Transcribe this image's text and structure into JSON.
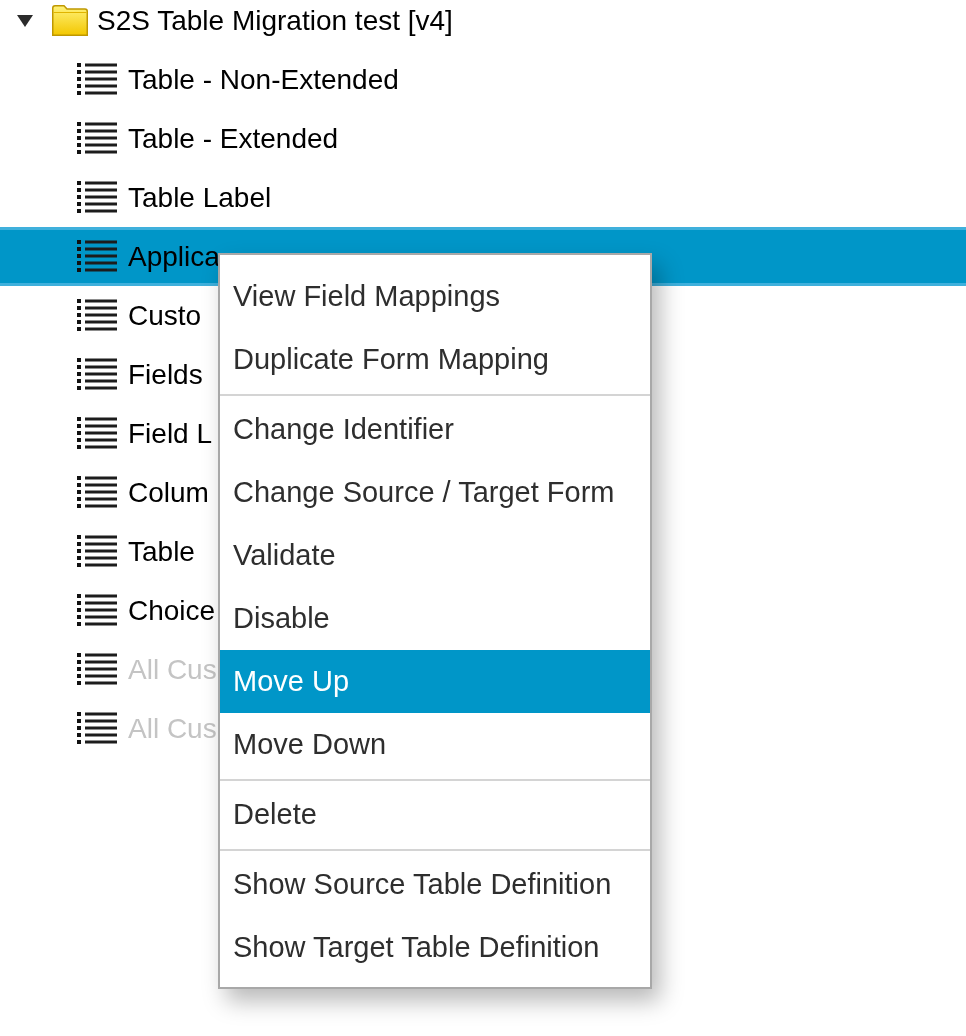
{
  "tree": {
    "root": {
      "label": "S2S Table Migration test [v4]",
      "expanded": true,
      "children": [
        {
          "label": "Table - Non-Extended",
          "selected": false,
          "disabled": false
        },
        {
          "label": "Table - Extended",
          "selected": false,
          "disabled": false
        },
        {
          "label": "Table Label",
          "selected": false,
          "disabled": false
        },
        {
          "label": "Applica",
          "selected": true,
          "disabled": false
        },
        {
          "label": "Custo",
          "selected": false,
          "disabled": false
        },
        {
          "label": "Fields",
          "selected": false,
          "disabled": false
        },
        {
          "label": "Field L",
          "selected": false,
          "disabled": false
        },
        {
          "label": "Colum",
          "selected": false,
          "disabled": false
        },
        {
          "label": "Table",
          "selected": false,
          "disabled": false
        },
        {
          "label": "Choice",
          "selected": false,
          "disabled": false
        },
        {
          "label": "All Cus",
          "selected": false,
          "disabled": true
        },
        {
          "label": "All Cus",
          "selected": false,
          "disabled": true
        }
      ]
    }
  },
  "context_menu": {
    "groups": [
      {
        "items": [
          {
            "label": "View Field Mappings",
            "selected": false
          },
          {
            "label": "Duplicate Form Mapping",
            "selected": false
          }
        ]
      },
      {
        "items": [
          {
            "label": "Change Identifier",
            "selected": false
          },
          {
            "label": "Change Source / Target Form",
            "selected": false
          },
          {
            "label": "Validate",
            "selected": false
          },
          {
            "label": "Disable",
            "selected": false
          },
          {
            "label": "Move Up",
            "selected": true
          },
          {
            "label": "Move Down",
            "selected": false
          }
        ]
      },
      {
        "items": [
          {
            "label": "Delete",
            "selected": false
          }
        ]
      },
      {
        "items": [
          {
            "label": "Show Source Table Definition",
            "selected": false
          },
          {
            "label": "Show Target Table Definition",
            "selected": false
          }
        ]
      }
    ]
  }
}
